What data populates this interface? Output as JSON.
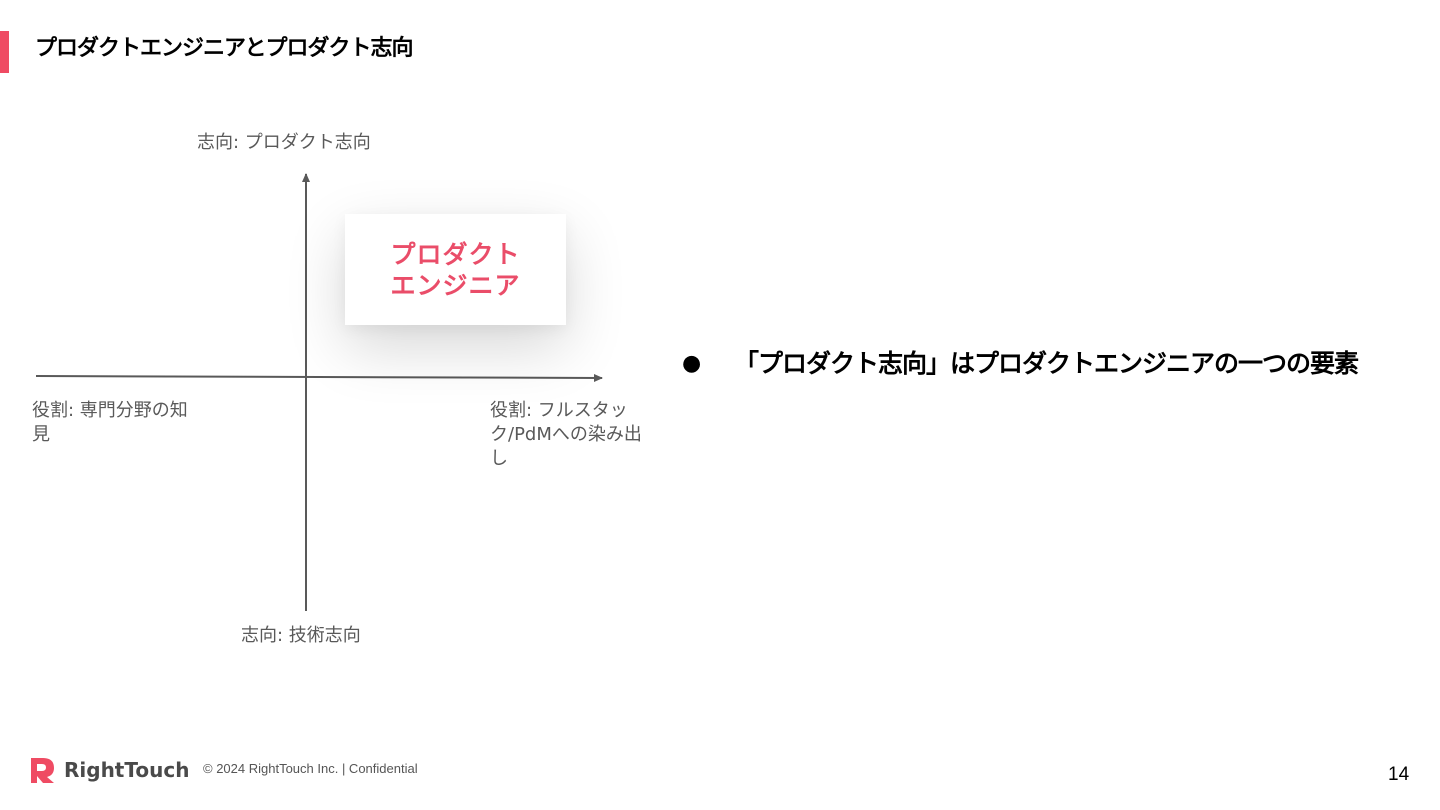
{
  "slide": {
    "title": "プロダクトエンジニアとプロダクト志向",
    "accent_color": "#ef4b63"
  },
  "diagram": {
    "axis_top": "志向: プロダクト志向",
    "axis_bottom": "志向: 技術志向",
    "axis_left": "役割: 専門分野の知見",
    "axis_right": "役割: フルスタック/PdMへの染み出し",
    "card_line1": "プロダクト",
    "card_line2": "エンジニア",
    "card_color": "#ea4d69"
  },
  "bullets": [
    {
      "marker": "●",
      "text": "「プロダクト志向」はプロダクトエンジニアの一つの要素"
    }
  ],
  "footer": {
    "brand": "RightTouch",
    "copyright": "© 2024 RightTouch Inc.  |  Confidential",
    "page_number": "14"
  }
}
